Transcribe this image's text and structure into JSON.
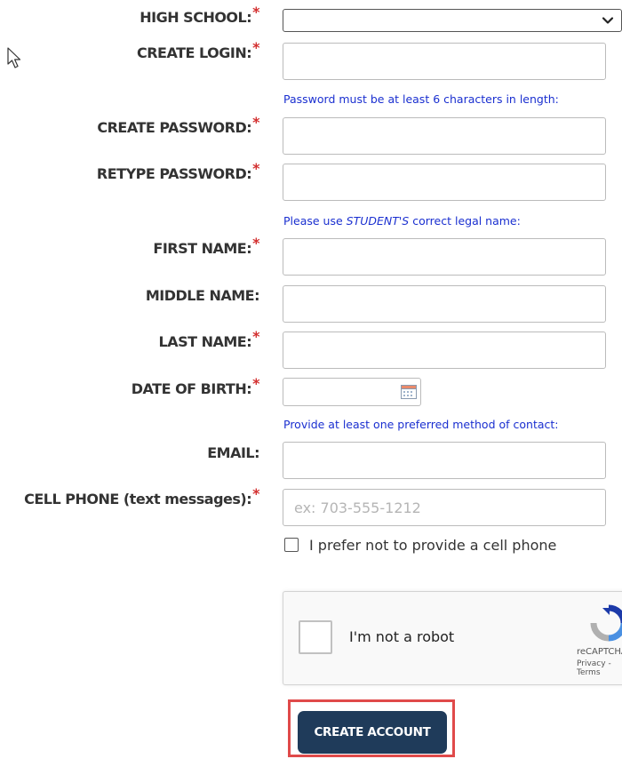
{
  "form": {
    "high_school": {
      "label": "HIGH SCHOOL:",
      "required_mark": "*",
      "selected": ""
    },
    "create_login": {
      "label": "CREATE LOGIN:",
      "required_mark": "*",
      "value": ""
    },
    "password_note": "Password must be at least 6 characters in length:",
    "create_password": {
      "label": "CREATE PASSWORD:",
      "required_mark": "*",
      "value": ""
    },
    "retype_password": {
      "label": "RETYPE PASSWORD:",
      "required_mark": "*",
      "value": ""
    },
    "name_note": {
      "prefix": "Please use ",
      "emphasis": "STUDENT'S",
      "suffix": " correct legal name:"
    },
    "first_name": {
      "label": "FIRST NAME:",
      "required_mark": "*",
      "value": ""
    },
    "middle_name": {
      "label": "MIDDLE NAME:",
      "value": ""
    },
    "last_name": {
      "label": "LAST NAME:",
      "required_mark": "*",
      "value": ""
    },
    "date_of_birth": {
      "label": "DATE OF BIRTH:",
      "required_mark": "*",
      "value": ""
    },
    "contact_note": "Provide at least one preferred method of contact:",
    "email": {
      "label": "EMAIL:",
      "value": ""
    },
    "cell_phone": {
      "label": "CELL PHONE (text messages):",
      "required_mark": "*",
      "value": "",
      "placeholder": "ex: 703-555-1212"
    },
    "no_cell_checkbox": {
      "label": "I prefer not to provide a cell phone",
      "checked": false
    }
  },
  "captcha": {
    "label": "I'm not a robot",
    "brand": "reCAPTCHA",
    "links": "Privacy - Terms",
    "checked": false
  },
  "submit": {
    "label": "CREATE ACCOUNT"
  },
  "colors": {
    "required": "#d32f2f",
    "note_text": "#1a2fd0",
    "button_bg": "#1f3b5a",
    "highlight": "#e04a4a"
  }
}
